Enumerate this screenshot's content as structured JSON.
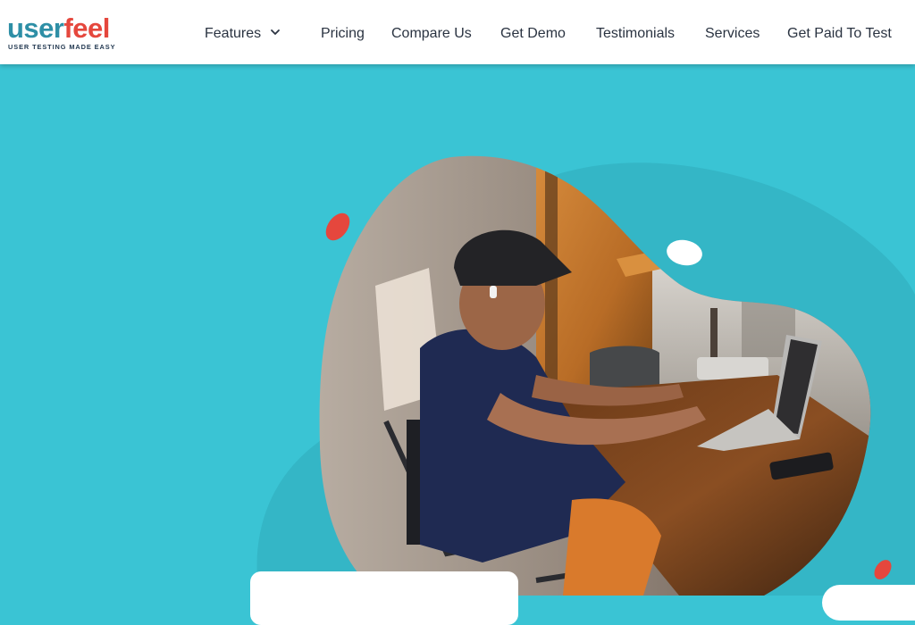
{
  "brand": {
    "name_part1": "user",
    "name_part2": "feel",
    "tagline": "USER TESTING MADE EASY",
    "colors": {
      "user": "#2e8fa6",
      "feel": "#e5473d",
      "tagline": "#243a52"
    }
  },
  "nav": {
    "items": [
      {
        "label": "Features",
        "has_dropdown": true,
        "icon": "chevron-down-icon"
      },
      {
        "label": "Pricing"
      },
      {
        "label": "Compare Us"
      },
      {
        "label": "Get Demo"
      },
      {
        "label": "Testimonials"
      },
      {
        "label": "Services"
      },
      {
        "label": "Get Paid To Test"
      }
    ]
  },
  "hero": {
    "background": "#3ac4d4",
    "blob_color": "#34b6c6",
    "accent_dot": "#e5473d",
    "image_subject": "photo of a man in a cap working on a laptop at a wooden desk"
  }
}
